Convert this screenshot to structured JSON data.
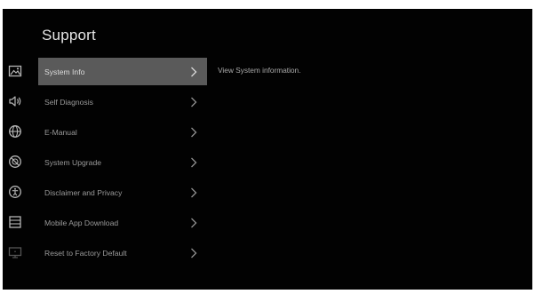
{
  "page": {
    "title": "Support"
  },
  "menu": {
    "items": [
      {
        "label": "System Info",
        "icon": "image-icon",
        "selected": true
      },
      {
        "label": "Self Diagnosis",
        "icon": "speaker-icon",
        "selected": false
      },
      {
        "label": "E-Manual",
        "icon": "globe-icon",
        "selected": false
      },
      {
        "label": "System Upgrade",
        "icon": "no-entry-icon",
        "selected": false
      },
      {
        "label": "Disclaimer and Privacy",
        "icon": "accessibility-icon",
        "selected": false
      },
      {
        "label": "Mobile App Download",
        "icon": "list-icon",
        "selected": false
      },
      {
        "label": "Reset to Factory Default",
        "icon": "monitor-icon",
        "selected": false
      }
    ]
  },
  "detail": {
    "description": "View System information."
  },
  "colors": {
    "background": "#020202",
    "selected": "#5a5a5a",
    "text": "#9a9a9a"
  }
}
